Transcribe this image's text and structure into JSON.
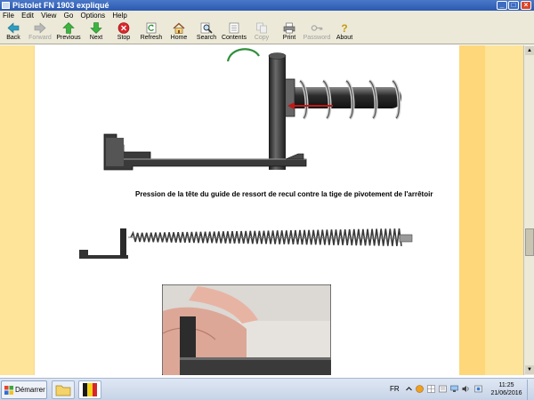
{
  "window": {
    "title": "Pistolet FN 1903 expliqué",
    "controls": {
      "minimize": "_",
      "maximize": "□",
      "close": "×"
    }
  },
  "menu": [
    "File",
    "Edit",
    "View",
    "Go",
    "Options",
    "Help"
  ],
  "toolbar": [
    {
      "label": "Back",
      "icon": "back-arrow-icon",
      "enabled": true
    },
    {
      "label": "Forward",
      "icon": "forward-arrow-icon",
      "enabled": false
    },
    {
      "label": "Previous",
      "icon": "up-arrow-icon",
      "enabled": true
    },
    {
      "label": "Next",
      "icon": "down-arrow-icon",
      "enabled": true
    },
    {
      "label": "Stop",
      "icon": "stop-icon",
      "enabled": true
    },
    {
      "label": "Refresh",
      "icon": "refresh-icon",
      "enabled": true
    },
    {
      "label": "Home",
      "icon": "home-icon",
      "enabled": true
    },
    {
      "label": "Search",
      "icon": "search-icon",
      "enabled": true
    },
    {
      "label": "Contents",
      "icon": "contents-icon",
      "enabled": true
    },
    {
      "label": "Copy",
      "icon": "copy-icon",
      "enabled": false
    },
    {
      "label": "Print",
      "icon": "print-icon",
      "enabled": true
    },
    {
      "label": "Password",
      "icon": "key-icon",
      "enabled": false
    },
    {
      "label": "About",
      "icon": "about-icon",
      "enabled": true
    }
  ],
  "content": {
    "caption": "Pression de la tête du guide de ressort de recul contre la tige de pivotement de l'arrêtoir"
  },
  "taskbar": {
    "start_label": "Démarrer",
    "language": "FR",
    "time": "11:25",
    "date": "21/06/2016"
  },
  "colors": {
    "page_border": "#fde499",
    "page_border_stripe": "#fdd77a",
    "title_bar": "#2a59b0",
    "stop_red": "#d9262b",
    "nav_green": "#2ea635"
  }
}
